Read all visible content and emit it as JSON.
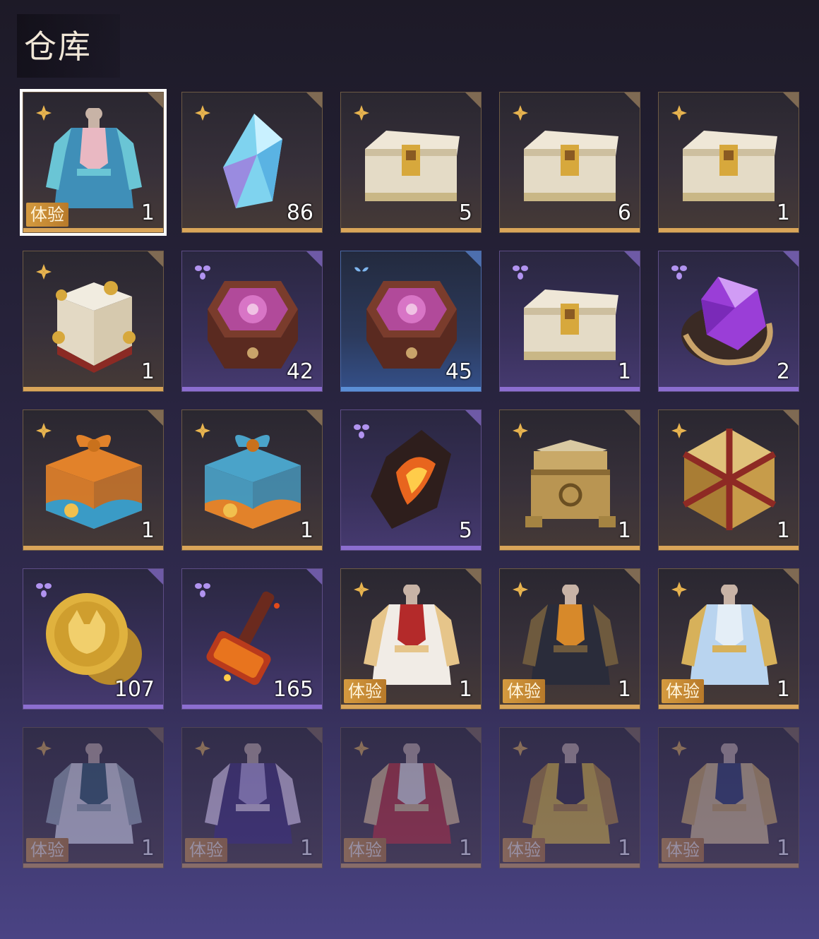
{
  "header": {
    "title": "仓库"
  },
  "colors": {
    "gold": "#d9a559",
    "purple": "#8c6ed0",
    "blue": "#5b8fd6",
    "trial_badge": "#d49a3f"
  },
  "items": [
    {
      "name": "outfit-cyan-robe",
      "rarity": "gold",
      "icon": "outfit-icon",
      "qty": "1",
      "badge": "体验",
      "selected": true
    },
    {
      "name": "crystal-blue",
      "rarity": "gold",
      "icon": "crystal-icon",
      "qty": "86"
    },
    {
      "name": "white-chest",
      "rarity": "gold",
      "icon": "chest-icon",
      "qty": "5"
    },
    {
      "name": "white-chest",
      "rarity": "gold",
      "icon": "chest-icon",
      "qty": "6"
    },
    {
      "name": "white-chest",
      "rarity": "gold",
      "icon": "chest-icon",
      "qty": "1"
    },
    {
      "name": "ornate-white-chest",
      "rarity": "gold",
      "icon": "ornate-chest-icon",
      "qty": "1"
    },
    {
      "name": "hexagon-box",
      "rarity": "purple",
      "icon": "hex-box-icon",
      "qty": "42"
    },
    {
      "name": "hexagon-box",
      "rarity": "blue",
      "icon": "hex-box-icon",
      "qty": "45"
    },
    {
      "name": "white-chest",
      "rarity": "purple",
      "icon": "chest-icon",
      "qty": "1"
    },
    {
      "name": "purple-gem",
      "rarity": "purple",
      "icon": "gem-icon",
      "qty": "2"
    },
    {
      "name": "orange-gift-bundle",
      "rarity": "gold",
      "icon": "gift-icon",
      "qty": "1"
    },
    {
      "name": "blue-gift-bundle",
      "rarity": "gold",
      "icon": "gift-icon",
      "qty": "1"
    },
    {
      "name": "fire-stone",
      "rarity": "purple",
      "icon": "fire-stone-icon",
      "qty": "5"
    },
    {
      "name": "golden-chest",
      "rarity": "gold",
      "icon": "golden-chest-icon",
      "qty": "1"
    },
    {
      "name": "red-gold-dice",
      "rarity": "gold",
      "icon": "dice-icon",
      "qty": "1"
    },
    {
      "name": "gold-coin",
      "rarity": "purple",
      "icon": "coin-icon",
      "qty": "107"
    },
    {
      "name": "red-hammer",
      "rarity": "purple",
      "icon": "hammer-icon",
      "qty": "165"
    },
    {
      "name": "outfit-red-white",
      "rarity": "gold",
      "icon": "outfit-icon",
      "qty": "1",
      "badge": "体验"
    },
    {
      "name": "outfit-dark-warrior",
      "rarity": "gold",
      "icon": "outfit-icon",
      "qty": "1",
      "badge": "体验"
    },
    {
      "name": "outfit-light-blue",
      "rarity": "gold",
      "icon": "outfit-icon",
      "qty": "1",
      "badge": "体验"
    },
    {
      "name": "outfit-white-coat",
      "rarity": "gold",
      "icon": "outfit-icon",
      "qty": "1",
      "badge": "体验",
      "faded": true
    },
    {
      "name": "outfit-purple-dress",
      "rarity": "gold",
      "icon": "outfit-icon",
      "qty": "1",
      "badge": "体验",
      "faded": true
    },
    {
      "name": "outfit-red-fur",
      "rarity": "gold",
      "icon": "outfit-icon",
      "qty": "1",
      "badge": "体验",
      "faded": true
    },
    {
      "name": "outfit-yellow-set",
      "rarity": "gold",
      "icon": "outfit-icon",
      "qty": "1",
      "badge": "体验",
      "faded": true
    },
    {
      "name": "outfit-gold-robe",
      "rarity": "gold",
      "icon": "outfit-icon",
      "qty": "1",
      "badge": "体验",
      "faded": true
    }
  ]
}
